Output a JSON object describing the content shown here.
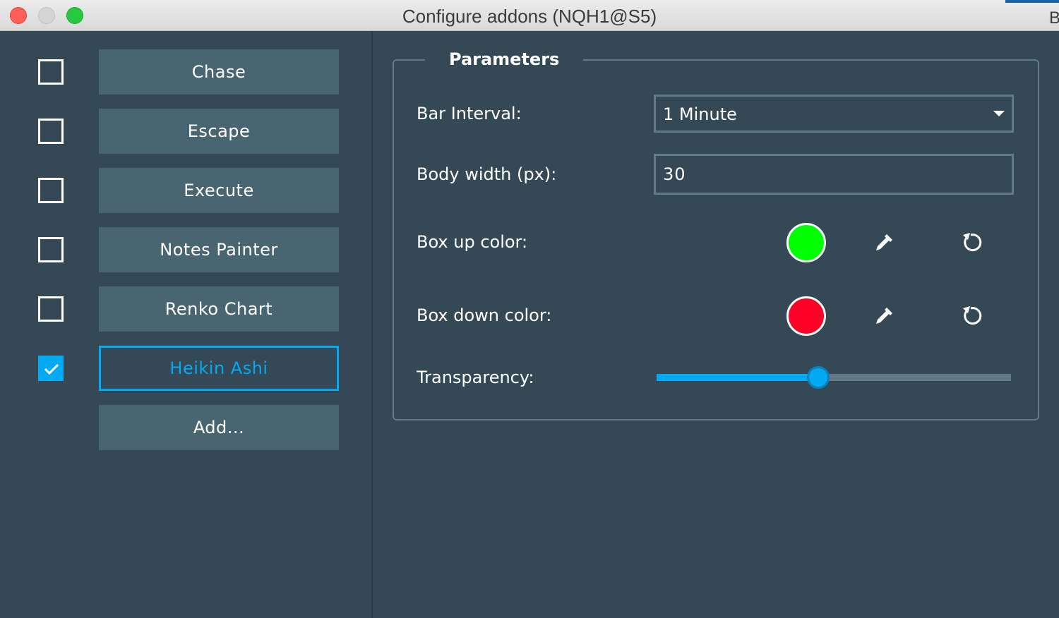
{
  "window": {
    "title": "Configure addons (NQH1@S5)",
    "edge_letter": "B"
  },
  "addons": [
    {
      "label": "Chase",
      "checked": false
    },
    {
      "label": "Escape",
      "checked": false
    },
    {
      "label": "Execute",
      "checked": false
    },
    {
      "label": "Notes Painter",
      "checked": false
    },
    {
      "label": "Renko Chart",
      "checked": false
    },
    {
      "label": "Heikin Ashi",
      "checked": true,
      "selected": true
    }
  ],
  "add_button": "Add...",
  "parameters": {
    "title": "Parameters",
    "bar_interval": {
      "label": "Bar Interval:",
      "value": "1 Minute"
    },
    "body_width": {
      "label": "Body width (px):",
      "value": "30"
    },
    "box_up_color": {
      "label": "Box up color:",
      "color": "#00ff00"
    },
    "box_down_color": {
      "label": "Box down color:",
      "color": "#ff0026"
    },
    "transparency": {
      "label": "Transparency:",
      "fraction": 0.457
    }
  },
  "colors": {
    "accent": "#04a9f4",
    "background": "#344955",
    "button": "#4a6572"
  },
  "icons": [
    "close-window-icon",
    "minimize-window-icon",
    "maximize-window-icon",
    "checkmark-icon",
    "dropdown-caret-icon",
    "eyedropper-icon",
    "reset-icon"
  ]
}
